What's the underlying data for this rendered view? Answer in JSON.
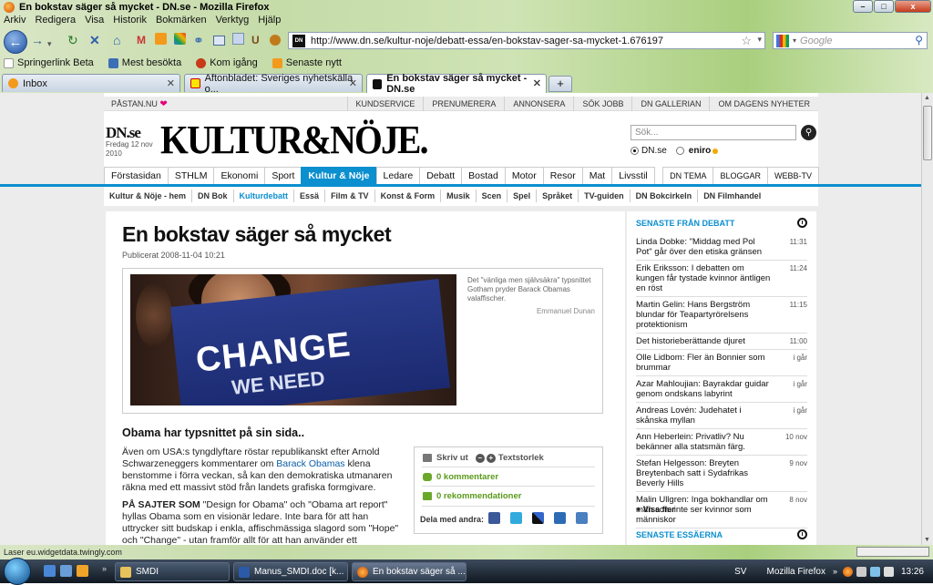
{
  "window": {
    "title": "En bokstav säger så mycket - DN.se - Mozilla Firefox",
    "controls": {
      "minimize": "–",
      "maximize": "□",
      "close": "x"
    }
  },
  "menu": [
    "Arkiv",
    "Redigera",
    "Visa",
    "Historik",
    "Bokmärken",
    "Verktyg",
    "Hjälp"
  ],
  "nav": {
    "url": "http://www.dn.se/kultur-noje/debatt-essa/en-bokstav-sager-sa-mycket-1.676197",
    "search_placeholder": "Google"
  },
  "bookmarks": [
    "Springerlink Beta",
    "Mest besökta",
    "Kom igång",
    "Senaste nytt"
  ],
  "tabs": [
    {
      "label": "Inbox",
      "active": false
    },
    {
      "label": "Aftonbladet: Sveriges nyhetskälla o...",
      "active": false
    },
    {
      "label": "En bokstav säger så mycket - DN.se",
      "active": true
    }
  ],
  "site": {
    "pastan": "PÅSTAN.NU",
    "toplinks": [
      "KUNDSERVICE",
      "PRENUMERERA",
      "ANNONSERA",
      "SÖK JOBB",
      "DN GALLERIAN",
      "OM DAGENS NYHETER"
    ],
    "logo": "DN.se",
    "date_line1": "Fredag 12 nov",
    "date_line2": "2010",
    "masthead": "KULTUR&NÖJE.",
    "search_placeholder": "Sök...",
    "radio1": "DN.se",
    "radio2": "eniro",
    "main_nav": [
      "Förstasidan",
      "STHLM",
      "Ekonomi",
      "Sport",
      "Kultur & Nöje",
      "Ledare",
      "Debatt",
      "Bostad",
      "Motor",
      "Resor",
      "Mat",
      "Livsstil"
    ],
    "main_nav_active": "Kultur & Nöje",
    "main_nav_right": [
      "DN TEMA",
      "BLOGGAR",
      "WEBB-TV"
    ],
    "sub_nav": [
      "Kultur & Nöje - hem",
      "DN Bok",
      "Kulturdebatt",
      "Essä",
      "Film & TV",
      "Konst & Form",
      "Musik",
      "Scen",
      "Spel",
      "Språket",
      "TV-guiden",
      "DN Bokcirkeln",
      "DN Filmhandel"
    ],
    "sub_nav_active": "Kulturdebatt"
  },
  "article": {
    "headline": "En bokstav säger så mycket",
    "published": "Publicerat 2008-11-04 10:21",
    "photo_text1": "CHANGE",
    "photo_text2": "WE NEED",
    "caption": "Det \"vänliga men självsäkra\" typsnittet Gotham pryder Barack Obamas valaffischer.",
    "photo_credit": "Emmanuel Dunan",
    "subhead": "Obama har typsnittet på sin sida..",
    "body1_pre": "Även om USA:s tyngdlyftare röstar republikanskt efter Arnold Schwarzeneggers kommentarer om ",
    "body1_link": "Barack Obamas",
    "body1_post": " klena benstomme i förra veckan, så kan den demokratiska utmanaren räkna med ett massivt stöd från landets grafiska formgivare.",
    "body2_lead": "PÅ SAJTER SOM",
    "body2_rest": " \"Design for Obama\" och \"Obama art report\" hyllas Obama som en visionär ledare. Inte bara för att han uttrycker sitt budskap i enkla, affischmässiga slagord som \"Hope\" och \"Change\" - utan framför allt för att han använder ett",
    "tools": {
      "print": "Skriv ut",
      "textsize": "Textstorlek",
      "comments": "0 kommentarer",
      "recommend": "0 rekommendationer",
      "share": "Dela med andra:"
    }
  },
  "sidebar": {
    "head1": "SENASTE FRÅN DEBATT",
    "items": [
      {
        "text": "Linda Dobke: \"Middag med Pol Pot\" går över den etiska gränsen",
        "time": "11:31"
      },
      {
        "text": "Erik Eriksson: I debatten om kungen får tystade kvinnor äntligen en röst",
        "time": "11:24"
      },
      {
        "text": "Martin Gelin: Hans Bergström blundar för Teapartyrörelsens protektionism",
        "time": "11:15"
      },
      {
        "text": "Det historieberättande djuret",
        "time": "11:00"
      },
      {
        "text": "Olle Lidbom: Fler än Bonnier som brummar",
        "time": "i går"
      },
      {
        "text": "Azar Mahloujian: Bayrakdar guidar genom ondskans labyrint",
        "time": "i går"
      },
      {
        "text": "Andreas Lovén: Judehatet i skånska myllan",
        "time": "i går"
      },
      {
        "text": "Ann Heberlein: Privatliv? Nu bekänner alla statsmän färg.",
        "time": "10 nov"
      },
      {
        "text": "Stefan Helgesson: Breyten Breytenbach satt i Sydafrikas Beverly Hills",
        "time": "9 nov"
      },
      {
        "text": "Malin Ullgren: Inga bokhandlar om män som inte ser kvinnor som människor",
        "time": "8 nov"
      }
    ],
    "more": "+ Visa fler",
    "head2": "SENASTE ESSÄERNA"
  },
  "status": {
    "text": "Laser eu.widgetdata.twingly.com"
  },
  "taskbar": {
    "items": [
      {
        "label": "SMDI",
        "active": false
      },
      {
        "label": "Manus_SMDI.doc [k...",
        "active": false
      },
      {
        "label": "En bokstav säger så ...",
        "active": true
      }
    ],
    "lang": "SV",
    "app": "Mozilla Firefox",
    "clock": "13:26"
  },
  "colors": {
    "accent": "#0b8fcf",
    "link": "#0b5fa8",
    "green": "#5a9a1a"
  }
}
